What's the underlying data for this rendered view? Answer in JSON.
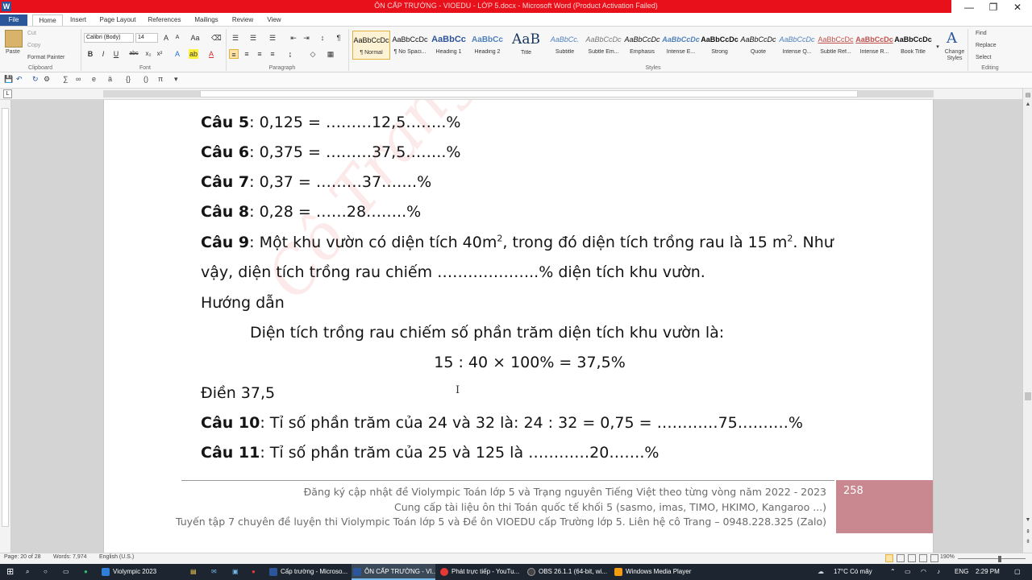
{
  "window": {
    "title": "ÔN CẤP TRƯỜNG - VIOEDU - LỚP 5.docx - Microsoft Word (Product Activation Failed)",
    "app_icon": "W",
    "controls": [
      "—",
      "❐",
      "✕"
    ]
  },
  "ribbon_tabs": [
    "File",
    "Home",
    "Insert",
    "Page Layout",
    "References",
    "Mailings",
    "Review",
    "View"
  ],
  "clipboard": {
    "paste": "Paste",
    "cut": "Cut",
    "copy": "Copy",
    "format_painter": "Format Painter",
    "label": "Clipboard"
  },
  "font": {
    "name": "Calibri (Body)",
    "size": "14",
    "label": "Font"
  },
  "paragraph": {
    "label": "Paragraph"
  },
  "styles": {
    "label": "Styles",
    "items": [
      {
        "sample": "AaBbCcDc",
        "name": "¶ Normal"
      },
      {
        "sample": "AaBbCcDc",
        "name": "¶ No Spaci..."
      },
      {
        "sample": "AaBbCc",
        "name": "Heading 1"
      },
      {
        "sample": "AaBbCc",
        "name": "Heading 2"
      },
      {
        "sample": "AaB",
        "name": "Title"
      },
      {
        "sample": "AaBbCc.",
        "name": "Subtitle"
      },
      {
        "sample": "AaBbCcDc",
        "name": "Subtle Em..."
      },
      {
        "sample": "AaBbCcDc",
        "name": "Emphasis"
      },
      {
        "sample": "AaBbCcDc",
        "name": "Intense E..."
      },
      {
        "sample": "AaBbCcDc",
        "name": "Strong"
      },
      {
        "sample": "AaBbCcDc",
        "name": "Quote"
      },
      {
        "sample": "AaBbCcDc",
        "name": "Intense Q..."
      },
      {
        "sample": "AaBbCcDc",
        "name": "Subtle Ref..."
      },
      {
        "sample": "AaBbCcDc",
        "name": "Intense R..."
      },
      {
        "sample": "AaBbCcDc",
        "name": "Book Title"
      }
    ],
    "change_styles": "Change Styles"
  },
  "editing": {
    "find": "Find",
    "replace": "Replace",
    "select": "Select",
    "label": "Editing"
  },
  "document": {
    "watermark": "Cô Trang",
    "q5": {
      "label": "Câu 5",
      "text": ": 0,125 = ………12,5……..%"
    },
    "q6": {
      "label": "Câu 6",
      "text": ": 0,375 = ………37,5……..%"
    },
    "q7": {
      "label": "Câu 7",
      "text": ": 0,37 = ………37…….%"
    },
    "q8": {
      "label": "Câu 8",
      "text": ": 0,28 = ……28……..%"
    },
    "q9": {
      "label": "Câu 9",
      "text_a": ": Một khu vườn có diện tích 40m",
      "sup1": "2",
      "text_b": ", trong đó diện tích trồng rau là 15 m",
      "sup2": "2",
      "text_c": ". Như",
      "line2": "vậy, diện tích trồng rau chiếm ………………..% diện tích khu vườn."
    },
    "guide_heading": "Hướng dẫn",
    "guide_line": "Diện tích trồng rau chiếm số phần trăm diện tích khu vườn là:",
    "formula": "15 : 40 × 100% = 37,5%",
    "answer": "Điền 37,5",
    "q10": {
      "label": "Câu 10",
      "text": ": Tỉ số phần trăm của 24 và 32 là: 24 : 32 = 0,75 = …………75……….%"
    },
    "q11": {
      "label": "Câu 11",
      "text": ": Tỉ số phần trăm của 25 và 125 là …………20…….%"
    },
    "footer": [
      "Đăng ký cập nhật đề Violympic Toán lớp 5 và Trạng nguyên Tiếng Việt theo từng vòng năm 2022 - 2023",
      "Cung cấp tài liệu ôn thi Toán quốc tế khối 5 (sasmo, imas, TIMO, HKIMO, Kangaroo ...)",
      "Tuyến tập 7 chuyên đề luyện thi Violympic Toán lớp 5 và Đề ôn VIOEDU cấp Trường lớp 5. Liên hệ cô Trang – 0948.228.325 (Zalo)"
    ],
    "page_number": "258"
  },
  "statusbar": {
    "page": "Page: 20 of 28",
    "words": "Words: 7,974",
    "language": "English (U.S.)",
    "zoom": "190%"
  },
  "taskbar": {
    "items": [
      {
        "label": "Violympic 2023",
        "color": "#2f7fd8"
      },
      {
        "label": "Cấp trường - Microso...",
        "color": "#2b579a"
      },
      {
        "label": "ÔN CẤP TRƯỜNG - VI...",
        "color": "#2b579a"
      },
      {
        "label": "Phát trực tiếp - YouTu...",
        "color": "#e53935"
      },
      {
        "label": "OBS 26.1.1 (64-bit, wi...",
        "color": "#444444"
      },
      {
        "label": "Windows Media Player",
        "color": "#f39c12"
      }
    ],
    "weather": "17°C Có mây",
    "lang": "ENG",
    "time": "2:29 PM"
  }
}
